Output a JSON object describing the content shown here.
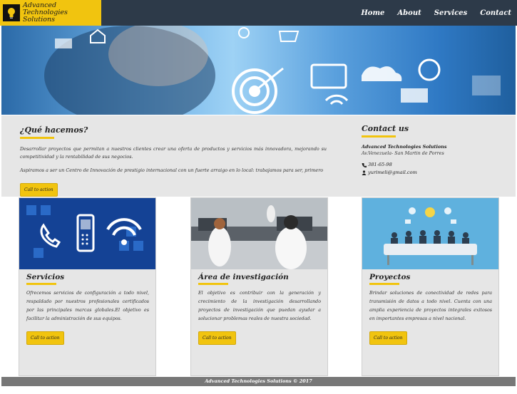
{
  "brand": {
    "name": "Advanced Technologies Solutions"
  },
  "nav": {
    "items": [
      "Home",
      "About",
      "Services",
      "Contact"
    ]
  },
  "about": {
    "title": "¿Qué hacemos?",
    "p1": "Desarrollar proyectos que permitan a nuestros clientes crear una oferta de productos y servicios más innovadora, mejorando su competitividad y la rentabilidad de sus negocios.",
    "p2": "Aspiramos a ser un Centro de Innovación de prestigio internacional con un fuerte arraigo en lo local: trabajamos para ser, primero",
    "button": "Call to action"
  },
  "contact": {
    "title": "Contact us",
    "company": "Advanced Technologies Solutions",
    "address": "Av.Venezuela- San Martin de Porres",
    "phone": "381-65-98",
    "email": "yurimeli@gmail.com"
  },
  "cards": [
    {
      "title": "Servicios",
      "text": "Ofrecemos servicios de configuración a todo nivel, respaldado por nuestros profesionales certificados por las principales marcas globales.El objetivo es facilitar la administración de sus equipos.",
      "button": "Call to action"
    },
    {
      "title": "Área de investigación",
      "text": "El objetivo es contribuir con la generación y crecimiento de la investigación desarrollando proyectos de investigación que puedan ayudar a solucionar problemas reales de nuestra sociedad.",
      "button": "Call to action"
    },
    {
      "title": "Proyectos",
      "text": "Brindar soluciones de conectividad de redes para transmisión de datos a todo nivel. Cuenta con una amplia experiencia de proyectos integrales exitosos en importantes empresas a nivel nacional.",
      "button": "Call to action"
    }
  ],
  "footer": {
    "text": "Advanced Technologies Solutions © 2017"
  },
  "colors": {
    "nav_bg": "#2d3a49",
    "accent": "#f1c40f",
    "band": "#e6e6e6",
    "footer": "#777777"
  }
}
